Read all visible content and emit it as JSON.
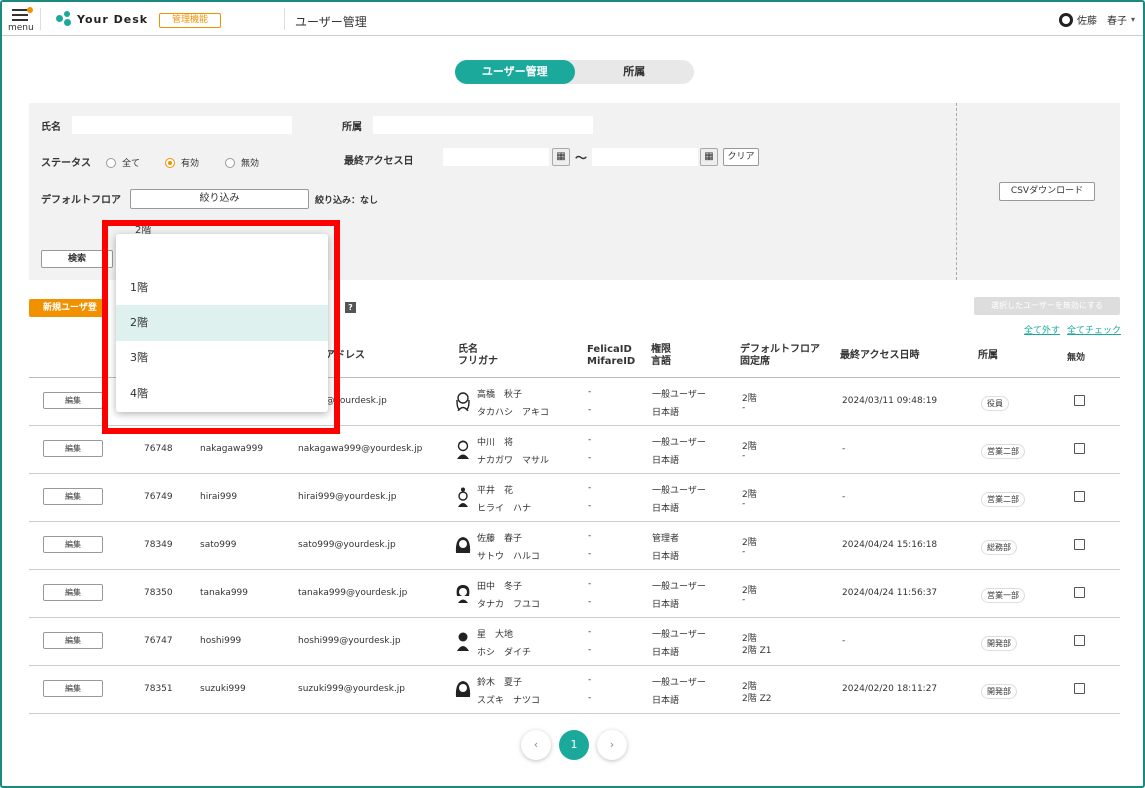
{
  "header": {
    "menu_label": "menu",
    "logo_text": "Your Desk",
    "admin_badge": "管理機能",
    "page_title": "ユーザー管理",
    "user_name": "佐藤　春子"
  },
  "tabs": [
    {
      "label": "ユーザー管理",
      "active": true
    },
    {
      "label": "所属",
      "active": false
    }
  ],
  "filter": {
    "name_label": "氏名",
    "name_value": "",
    "dept_label": "所属",
    "dept_value": "",
    "status_label": "ステータス",
    "status_options": [
      {
        "label": "全て",
        "checked": false
      },
      {
        "label": "有効",
        "checked": true
      },
      {
        "label": "無効",
        "checked": false
      }
    ],
    "last_access_label": "最終アクセス日",
    "date_from": "",
    "date_to": "",
    "tilde": "〜",
    "clear_label": "クリア",
    "default_floor_label": "デフォルトフロア",
    "narrow_button": "絞り込み",
    "narrow_status": "絞り込み：なし",
    "search_button": "検索",
    "csv_button": "CSVダウンロード"
  },
  "toolbar": {
    "new_user_button": "新規ユーザ登録",
    "disable_selected_button": "選択したユーザーを無効にする",
    "uncheck_all": "全て外す",
    "check_all": "全てチェック"
  },
  "table": {
    "headers": {
      "email": "アドレス",
      "name": "氏名",
      "furigana": "フリガナ",
      "felica": "FelicaID",
      "mifare": "MifareID",
      "role": "権限",
      "lang": "言語",
      "floor": "デフォルトフロア",
      "seat": "固定席",
      "last_access": "最終アクセス日時",
      "dept": "所属",
      "disabled": "無効"
    },
    "edit_label": "編集",
    "rows": [
      {
        "id": "",
        "login": "",
        "email": "sh999@yourdesk.jp",
        "name": "高橋　秋子",
        "kana": "タカハシ　アキコ",
        "felica": "-",
        "mifare": "-",
        "role": "一般ユーザー",
        "lang": "日本語",
        "floor": "2階",
        "seat": "-",
        "last_access": "2024/03/11 09:48:19",
        "dept": "役員",
        "icon": "woman-longhair-icon"
      },
      {
        "id": "76748",
        "login": "nakagawa999",
        "email": "nakagawa999@yourdesk.jp",
        "name": "中川　将",
        "kana": "ナカガワ　マサル",
        "felica": "-",
        "mifare": "-",
        "role": "一般ユーザー",
        "lang": "日本語",
        "floor": "2階",
        "seat": "-",
        "last_access": "-",
        "dept": "営業二部",
        "icon": "man-icon"
      },
      {
        "id": "76749",
        "login": "hirai999",
        "email": "hirai999@yourdesk.jp",
        "name": "平井　花",
        "kana": "ヒライ　ハナ",
        "felica": "-",
        "mifare": "-",
        "role": "一般ユーザー",
        "lang": "日本語",
        "floor": "2階",
        "seat": "-",
        "last_access": "-",
        "dept": "営業二部",
        "icon": "woman-bun-icon"
      },
      {
        "id": "78349",
        "login": "sato999",
        "email": "sato999@yourdesk.jp",
        "name": "佐藤　春子",
        "kana": "サトウ　ハルコ",
        "felica": "-",
        "mifare": "-",
        "role": "管理者",
        "lang": "日本語",
        "floor": "2階",
        "seat": "-",
        "last_access": "2024/04/24 15:16:18",
        "dept": "総務部",
        "icon": "woman-icon"
      },
      {
        "id": "78350",
        "login": "tanaka999",
        "email": "tanaka999@yourdesk.jp",
        "name": "田中　冬子",
        "kana": "タナカ　フユコ",
        "felica": "-",
        "mifare": "-",
        "role": "一般ユーザー",
        "lang": "日本語",
        "floor": "2階",
        "seat": "-",
        "last_access": "2024/04/24 11:56:37",
        "dept": "営業一部",
        "icon": "woman-short-icon"
      },
      {
        "id": "76747",
        "login": "hoshi999",
        "email": "hoshi999@yourdesk.jp",
        "name": "星　大地",
        "kana": "ホシ　ダイチ",
        "felica": "-",
        "mifare": "-",
        "role": "一般ユーザー",
        "lang": "日本語",
        "floor": "2階",
        "seat": "2階 Z1",
        "last_access": "-",
        "dept": "開発部",
        "icon": "man-icon"
      },
      {
        "id": "78351",
        "login": "suzuki999",
        "email": "suzuki999@yourdesk.jp",
        "name": "鈴木　夏子",
        "kana": "スズキ　ナツコ",
        "felica": "-",
        "mifare": "-",
        "role": "一般ユーザー",
        "lang": "日本語",
        "floor": "2階",
        "seat": "2階 Z2",
        "last_access": "2024/02/20 18:11:27",
        "dept": "開発部",
        "icon": "woman-icon"
      }
    ]
  },
  "pagination": {
    "prev": "‹",
    "current": "1",
    "next": "›"
  },
  "dropdown": {
    "ghost_value": "2階",
    "options": [
      "",
      "1階",
      "2階",
      "3階",
      "4階"
    ],
    "selected": "2階"
  },
  "colors": {
    "accent": "#1aa99b",
    "orange": "#f29100",
    "highlight": "#ff0000"
  }
}
